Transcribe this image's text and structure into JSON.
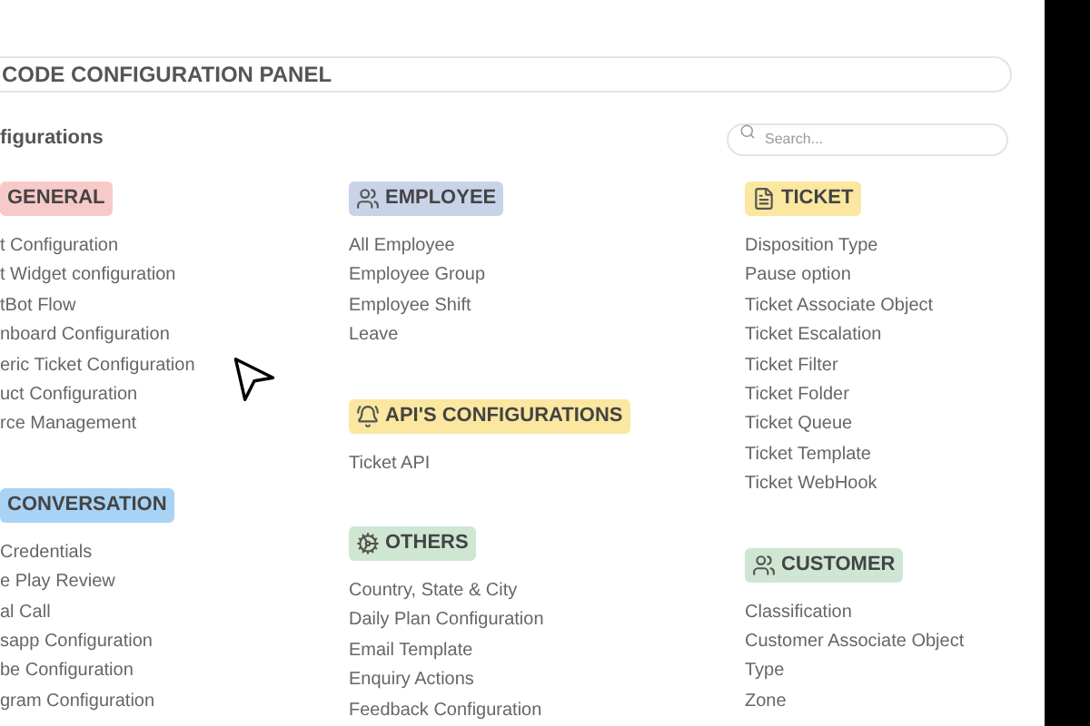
{
  "panel_title": "CODE CONFIGURATION PANEL",
  "heading": "figurations",
  "search": {
    "placeholder": "Search..."
  },
  "columns": [
    {
      "sections": [
        {
          "title": "GENERAL",
          "kind": "none",
          "color": "#f8c9c9",
          "items": [
            "t Configuration",
            "t Widget configuration",
            "tBot Flow",
            "nboard Configuration",
            "eric Ticket Configuration",
            "uct Configuration",
            "rce Management"
          ]
        },
        {
          "title": "CONVERSATION",
          "kind": "none",
          "color": "#a9d3f5",
          "items": [
            "Credentials",
            "e Play Review",
            "al Call",
            "sapp Configuration",
            "be Configuration",
            "gram Configuration"
          ]
        }
      ]
    },
    {
      "sections": [
        {
          "title": "EMPLOYEE",
          "kind": "users",
          "color": "#c9d3e8",
          "items": [
            "All Employee",
            "Employee Group",
            "Employee Shift",
            "Leave"
          ]
        },
        {
          "title": "API'S CONFIGURATIONS",
          "kind": "bell",
          "color": "#fbe7a0",
          "items": [
            "Ticket API"
          ]
        },
        {
          "title": "OTHERS",
          "kind": "gears",
          "color": "#cfe6d3",
          "items": [
            "Country, State & City",
            "Daily Plan Configuration",
            "Email Template",
            "Enquiry Actions",
            "Feedback Configuration"
          ]
        }
      ]
    },
    {
      "sections": [
        {
          "title": "TICKET",
          "kind": "document",
          "color": "#fbe7a0",
          "items": [
            "Disposition Type",
            "Pause option",
            "Ticket Associate Object",
            "Ticket Escalation",
            "Ticket Filter",
            "Ticket Folder",
            "Ticket Queue",
            "Ticket Template",
            "Ticket WebHook"
          ]
        },
        {
          "title": "CUSTOMER",
          "kind": "users",
          "color": "#cfe6d3",
          "items": [
            "Classification",
            "Customer Associate Object",
            "Type",
            "Zone"
          ]
        }
      ]
    }
  ]
}
